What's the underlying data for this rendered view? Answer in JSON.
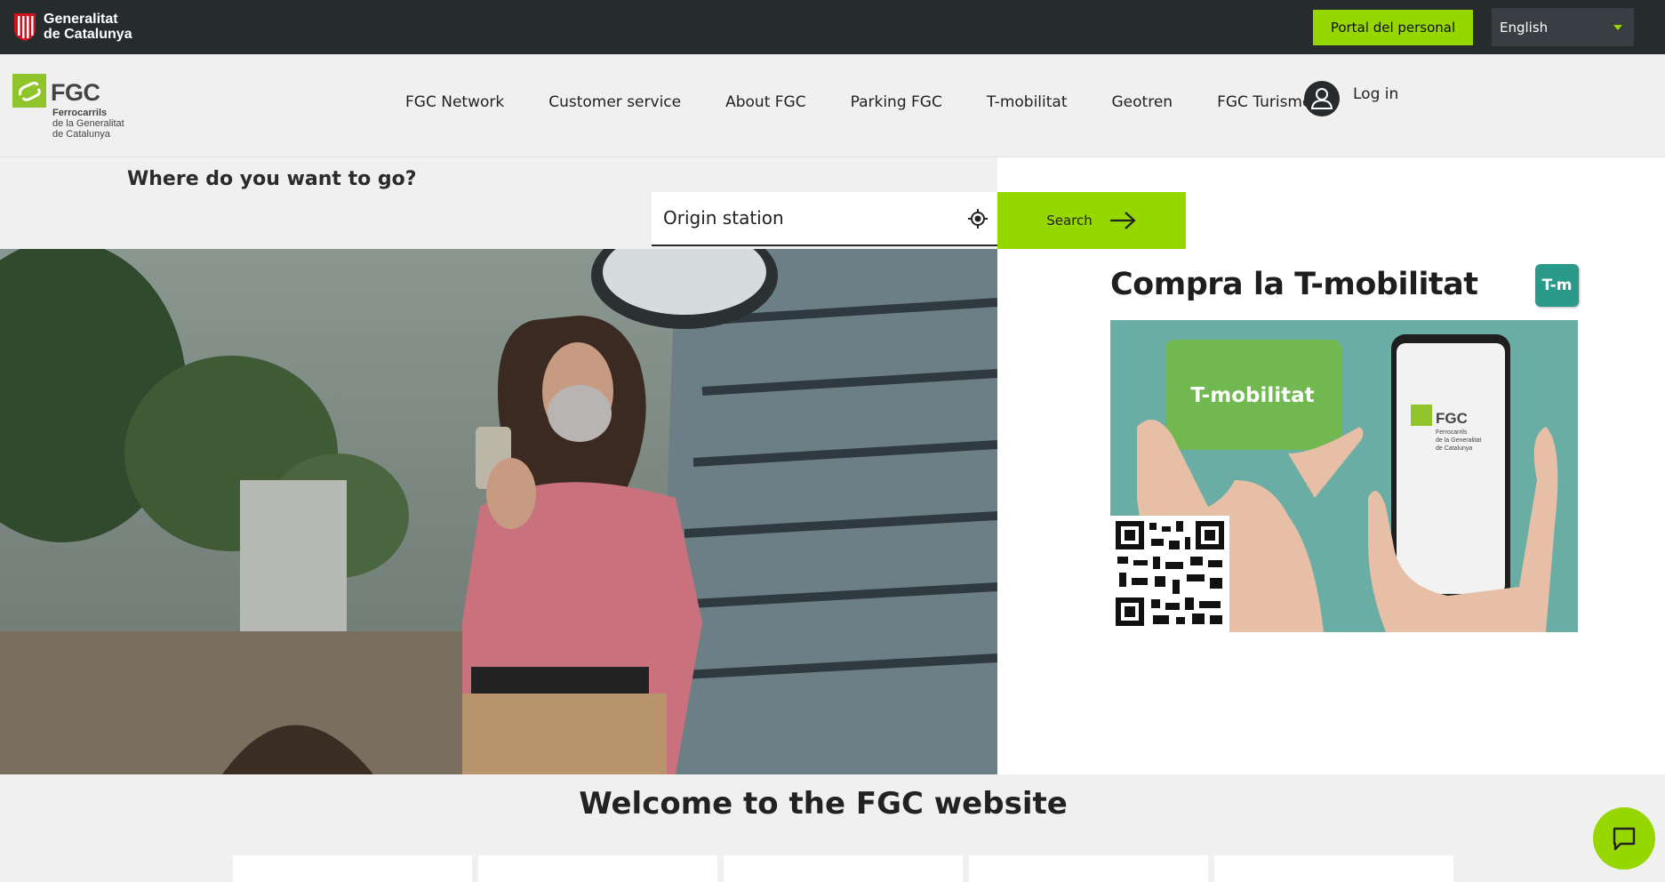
{
  "topbar": {
    "gov_name_line1": "Generalitat",
    "gov_name_line2": "de Catalunya",
    "portal_button": "Portal del personal",
    "language": "English"
  },
  "header": {
    "logo_name": "FGC",
    "logo_sub1": "Ferrocarrils",
    "logo_sub2": "de la Generalitat",
    "logo_sub3": "de Catalunya",
    "nav": [
      "FGC Network",
      "Customer service",
      "About FGC",
      "Parking FGC",
      "T-mobilitat",
      "Geotren",
      "FGC Turisme"
    ],
    "login_label": "Log in"
  },
  "search": {
    "heading": "Where do you want to go?",
    "origin_placeholder": "Origin station",
    "button_label": "Search"
  },
  "promo": {
    "title": "Compra la T-mobilitat",
    "badge": "T-m",
    "card_text": "T-mobilitat",
    "phone_logo": "FGC",
    "phone_sub1": "Ferrocarrils",
    "phone_sub2": "de la Generalitat",
    "phone_sub3": "de Catalunya"
  },
  "welcome": {
    "title": "Welcome to the FGC website"
  },
  "colors": {
    "accent_green": "#97d700",
    "topbar_dark": "#262b2e",
    "teal": "#2a9a8a"
  },
  "icons": [
    "generalitat-logo-icon",
    "caret-down-icon",
    "user-icon",
    "location-target-icon",
    "arrow-right-icon",
    "chat-icon",
    "qr-code-icon"
  ]
}
